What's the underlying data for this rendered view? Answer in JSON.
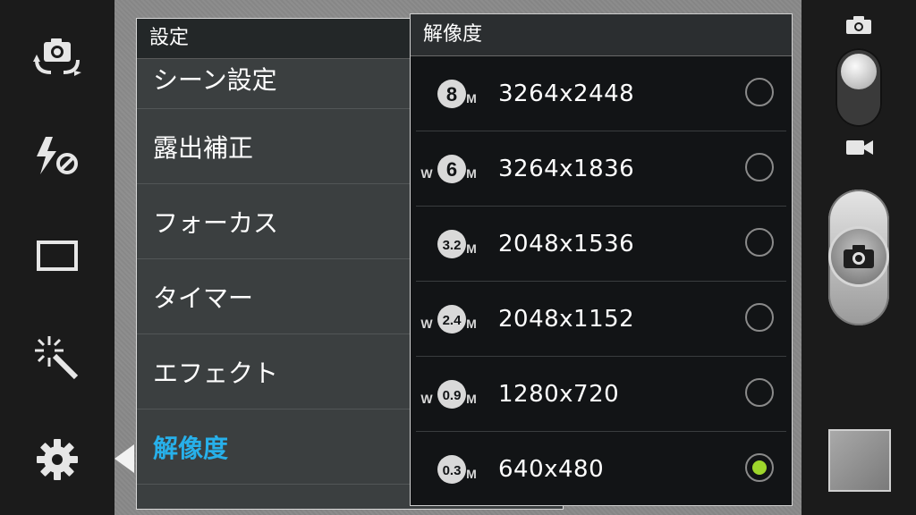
{
  "settings": {
    "title": "設定",
    "items": [
      {
        "label": "シーン設定"
      },
      {
        "label": "露出補正"
      },
      {
        "label": "フォーカス"
      },
      {
        "label": "タイマー"
      },
      {
        "label": "エフェクト"
      },
      {
        "label": "解像度",
        "active": true
      }
    ]
  },
  "resolution": {
    "title": "解像度",
    "options": [
      {
        "badge": "8M",
        "label": "3264x2448",
        "selected": false
      },
      {
        "badge": "W6M",
        "label": "3264x1836",
        "selected": false
      },
      {
        "badge": "3.2M",
        "label": "2048x1536",
        "selected": false
      },
      {
        "badge": "W2.4M",
        "label": "2048x1152",
        "selected": false
      },
      {
        "badge": "W0.9M",
        "label": "1280x720",
        "selected": false
      },
      {
        "badge": "0.3M",
        "label": "640x480",
        "selected": true
      }
    ]
  },
  "icons": {
    "left_rail": [
      "camera-switch-icon",
      "flash-off-icon",
      "aspect-ratio-icon",
      "effect-wand-icon",
      "settings-gear-icon"
    ],
    "right_rail": [
      "photo-mode-icon",
      "video-mode-icon",
      "shutter-camera-icon"
    ]
  },
  "colors": {
    "active_text": "#27b0ea",
    "radio_selected": "#9ed62b"
  }
}
